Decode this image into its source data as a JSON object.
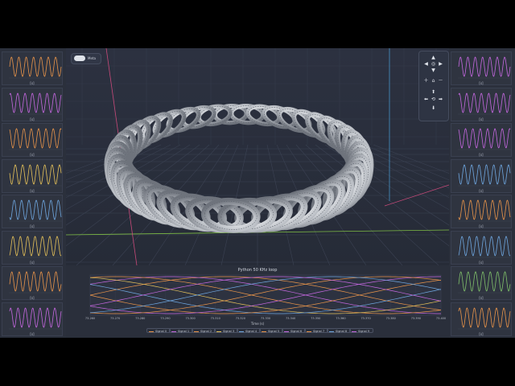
{
  "toggle": {
    "label": "Meta"
  },
  "chart": {
    "title": "Python 50 KHz loop",
    "xlabel": "Time (s)",
    "x_ticks": [
      "73.260",
      "73.270",
      "73.280",
      "73.290",
      "73.300",
      "73.310",
      "73.320",
      "73.330",
      "73.340",
      "73.350",
      "73.360",
      "73.370",
      "73.380",
      "73.390",
      "73.400"
    ],
    "legend": [
      "Signal 0",
      "Signal 1",
      "Signal 2",
      "Signal 3",
      "Signal 4",
      "Signal 5",
      "Signal 6",
      "Signal 7",
      "Signal 8",
      "Signal 9"
    ]
  },
  "mini_chart": {
    "x_label": "[s]"
  },
  "colors": {
    "series": [
      "#e8944a",
      "#c568e0",
      "#e8944a",
      "#e6c25a",
      "#6fa7e0",
      "#e8944a",
      "#c568e0",
      "#e8944a",
      "#6fa7e0",
      "#c568e0"
    ],
    "left_panels": [
      "#e8944a",
      "#c568e0",
      "#e8944a",
      "#e6c25a",
      "#6fa7e0",
      "#e6c25a",
      "#e8944a",
      "#c568e0"
    ],
    "right_panels": [
      "#c568e0",
      "#c568e0",
      "#c568e0",
      "#6fa7e0",
      "#e8944a",
      "#6fa7e0",
      "#7fbf6a",
      "#e8944a"
    ]
  },
  "nav_icons": [
    "arrow-up-icon",
    "arrow-left-icon",
    "recenter-icon",
    "arrow-right-icon",
    "arrow-down-icon",
    "zoom-in-icon",
    "home-icon",
    "zoom-out-icon",
    "move-up-icon",
    "move-left-icon",
    "rotate-icon",
    "move-right-icon",
    "move-down-icon"
  ]
}
